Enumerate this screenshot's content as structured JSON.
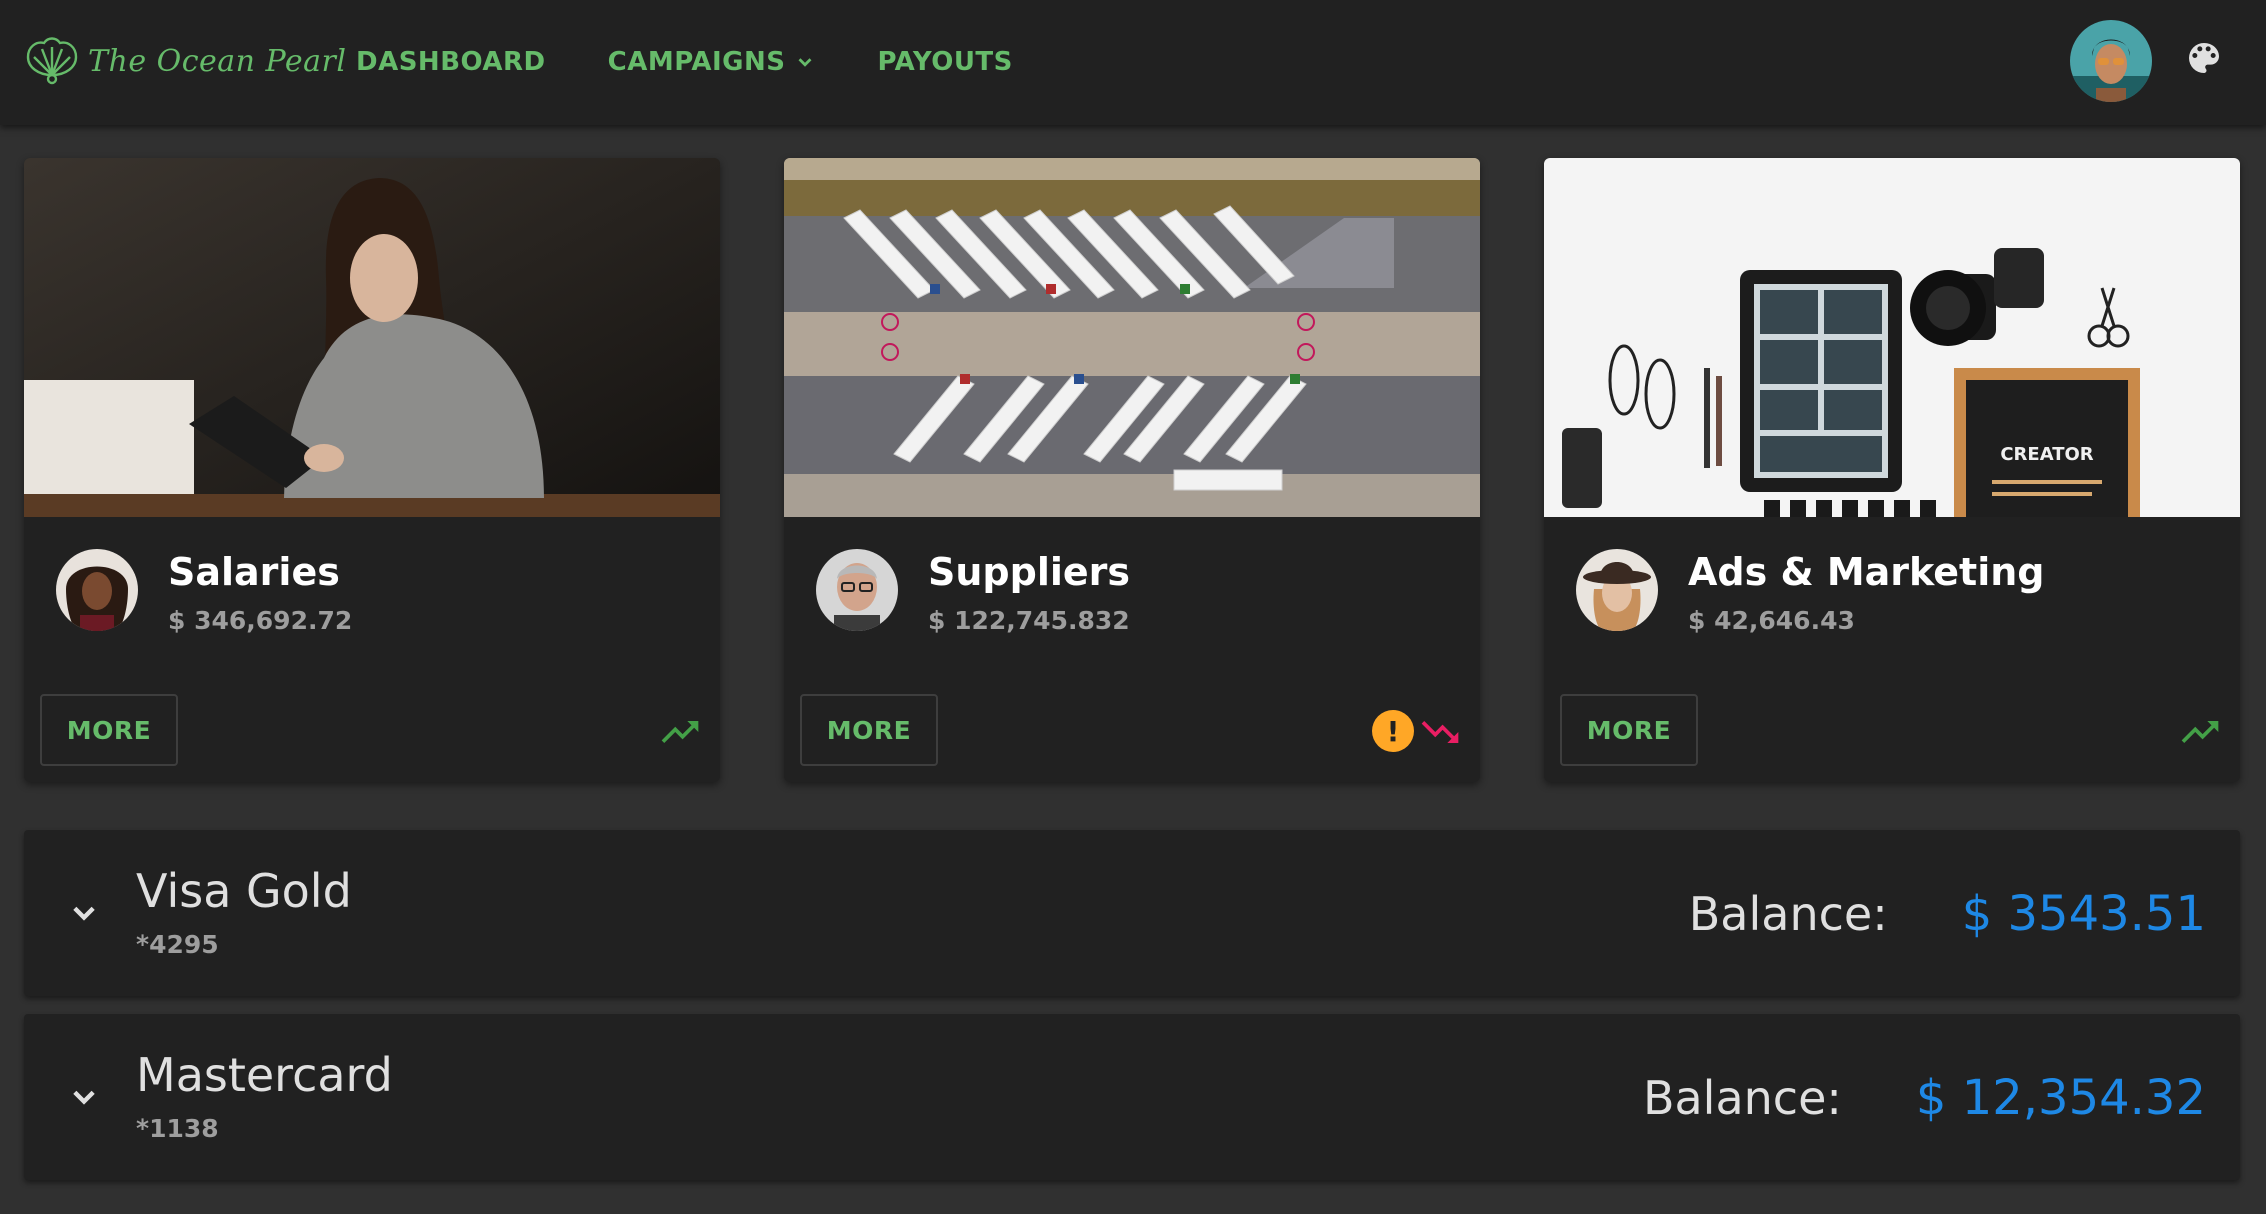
{
  "brand": {
    "name": "The Ocean Pearl",
    "color": "#66bb6a"
  },
  "nav": {
    "items": [
      {
        "label": "DASHBOARD",
        "icon": null
      },
      {
        "label": "CAMPAIGNS",
        "icon": "chevron-down-icon"
      },
      {
        "label": "PAYOUTS",
        "icon": null
      }
    ]
  },
  "header_actions": {
    "avatar": "user-avatar",
    "theme_icon": "palette-icon"
  },
  "cards": [
    {
      "title": "Salaries",
      "amount": "$ 346,692.72",
      "button": "MORE",
      "trend": "trending-up-icon",
      "warning": null
    },
    {
      "title": "Suppliers",
      "amount": "$ 122,745.832",
      "button": "MORE",
      "trend": "trending-down-icon",
      "warning": "!"
    },
    {
      "title": "Ads & Marketing",
      "amount": "$ 42,646.43",
      "button": "MORE",
      "trend": "trending-up-icon",
      "warning": null
    }
  ],
  "accounts": [
    {
      "name": "Visa Gold",
      "number": "*4295",
      "balance_label": "Balance:",
      "balance": "$ 3543.51"
    },
    {
      "name": "Mastercard",
      "number": "*1138",
      "balance_label": "Balance:",
      "balance": "$ 12,354.32"
    }
  ],
  "colors": {
    "accent": "#66bb6a",
    "trend_up": "#43a047",
    "trend_down": "#e91e63",
    "warning": "#ffa726",
    "balance": "#1e88e5",
    "surface": "#212121",
    "background": "#303030"
  }
}
